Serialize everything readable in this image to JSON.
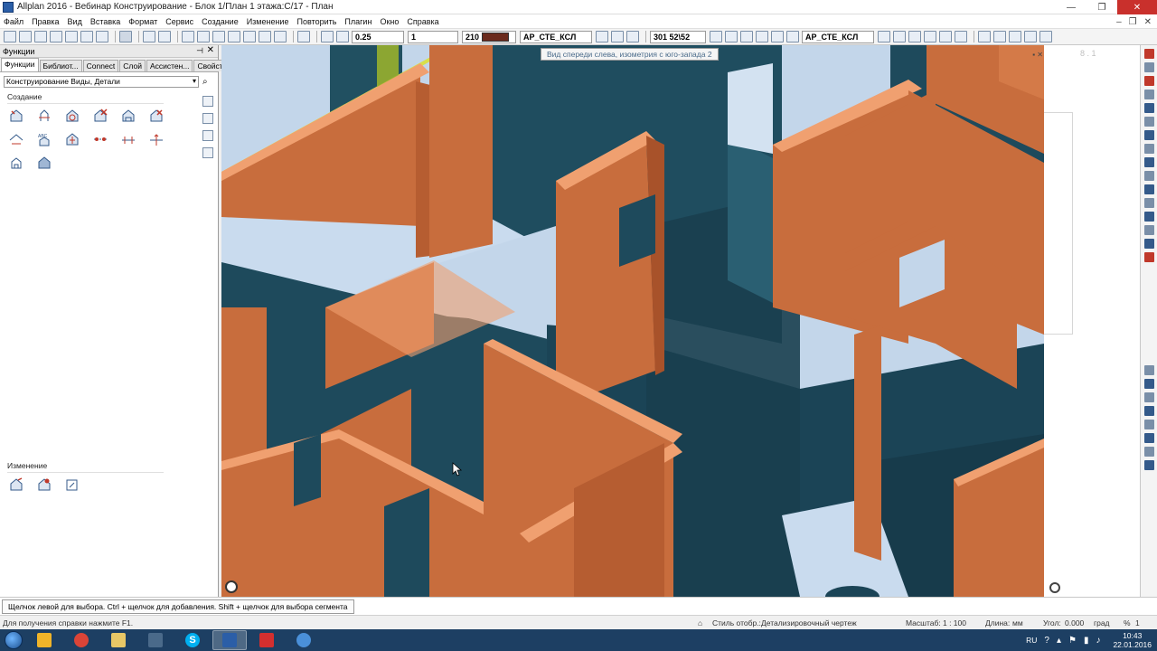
{
  "window": {
    "title": "Allplan 2016 - Вебинар Конструирование - Блок 1/План 1 этажа:C/17 - План",
    "minimize": "—",
    "maximize": "❐",
    "close": "✕"
  },
  "menu": [
    "Файл",
    "Правка",
    "Вид",
    "Вставка",
    "Формат",
    "Сервис",
    "Создание",
    "Изменение",
    "Повторить",
    "Плагин",
    "Окно",
    "Справка"
  ],
  "toolbar": {
    "pen_value": "0.25",
    "line_value": "1",
    "color_value": "210",
    "layer1": "АР_СТЕ_КСЛ",
    "scale_value": "301",
    "scale_label": "52\\52",
    "layer2": "АР_СТЕ_КСЛ",
    "colors": {
      "color_swatch": "#6b2a1c"
    }
  },
  "left_panel": {
    "header": "Функции",
    "pin": "⊣",
    "close": "✕",
    "tabs": [
      "Функции",
      "Библиот...",
      "Connect",
      "Слой",
      "Ассистен...",
      "Свойства"
    ],
    "module": "Конструирование Виды, Детали",
    "section_create": "Создание",
    "section_modify": "Изменение"
  },
  "viewport": {
    "tooltip": "Вид спереди слева, изометрия с юго-запада 2",
    "colors": {
      "background": "#c3d6ea",
      "walls": "#c86d3d",
      "glass": "#1e4a5c"
    }
  },
  "right_zone": {
    "tag": "8 . 1"
  },
  "prompt": "Щелчок левой для выбора. Ctrl + щелчок для добавления. Shift + щелчок для выбора сегмента",
  "status": {
    "help": "Для получения справки нажмите F1.",
    "style_label": "Стиль отобр.:",
    "style_value": "Детализировочный чертеж",
    "scale_label": "Масштаб:",
    "scale_value": "1 : 100",
    "length_label": "Длина:",
    "length_value": "мм",
    "angle_label": "Угол:",
    "angle_value": "0.000",
    "angle_unit": "град",
    "percent": "%",
    "count": "1"
  },
  "taskbar": {
    "lang": "RU",
    "time": "10:43",
    "date": "22.01.2016",
    "apps": [
      "windows-explorer-icon",
      "chrome-icon",
      "folder-icon",
      "calculator-icon",
      "skype-icon",
      "allplan-icon",
      "acrobat-icon",
      "settings-icon"
    ]
  }
}
